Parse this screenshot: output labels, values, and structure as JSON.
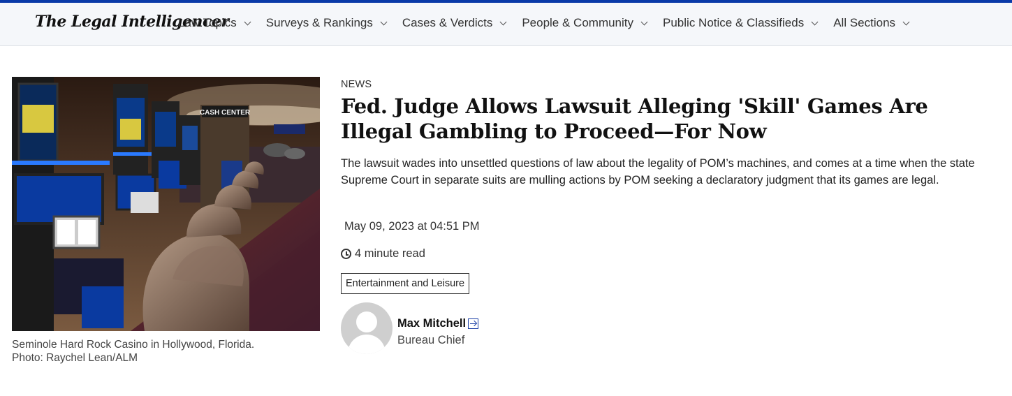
{
  "header": {
    "logo": "The Legal Intelligencer",
    "nav": [
      {
        "label": "Law Topics"
      },
      {
        "label": "Surveys & Rankings"
      },
      {
        "label": "Cases & Verdicts"
      },
      {
        "label": "People & Community"
      },
      {
        "label": "Public Notice & Classifieds"
      },
      {
        "label": "All Sections"
      }
    ],
    "accent_color": "#0a3aa8"
  },
  "article": {
    "kicker": "NEWS",
    "headline": "Fed. Judge Allows Lawsuit Alleging 'Skill' Games Are Illegal Gambling to Proceed—For Now",
    "summary": "The lawsuit wades into unsettled questions of law about the legality of POM’s machines, and comes at a time when the state Supreme Court in separate suits are mulling actions by POM seeking a declaratory judgment that its games are legal.",
    "date": "May 09, 2023 at 04:51 PM",
    "read_time": "4 minute read",
    "tag": "Entertainment and Leisure",
    "image_caption_line1": "Seminole Hard Rock Casino in Hollywood, Florida.",
    "image_caption_line2": "Photo: Raychel Lean/ALM",
    "image_sign_text": "CASH CENTER"
  },
  "author": {
    "name": "Max Mitchell",
    "title": "Bureau Chief",
    "follow_icon": "follow-arrow-icon"
  }
}
